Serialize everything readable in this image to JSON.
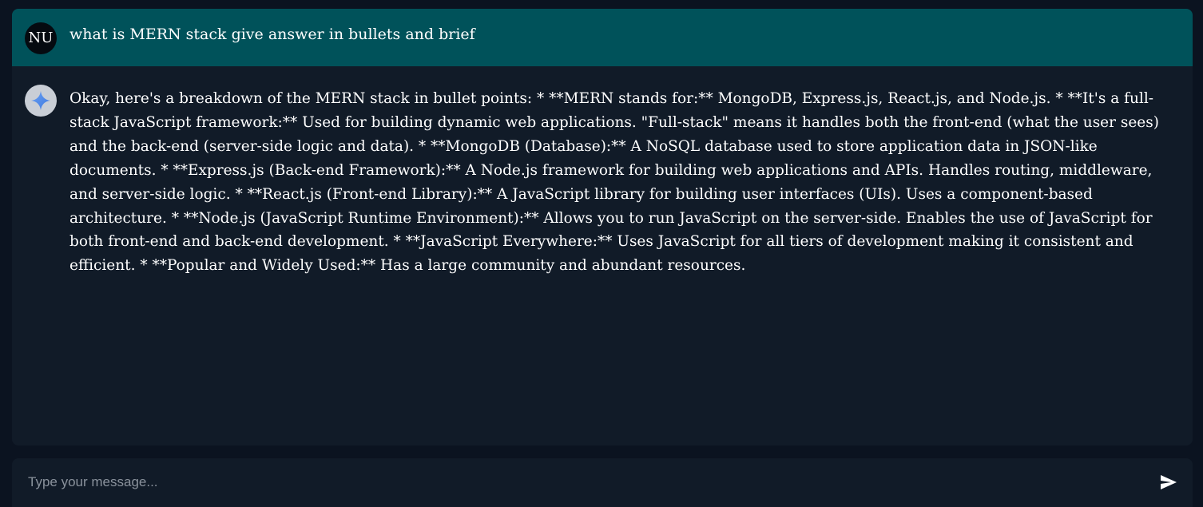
{
  "conversation": {
    "user_message": {
      "avatar_initials": "NU",
      "text": "what is MERN stack give answer in bullets and brief"
    },
    "bot_message": {
      "avatar_icon": "sparkle-icon",
      "text": "Okay, here's a breakdown of the MERN stack in bullet points: * **MERN stands for:** MongoDB, Express.js, React.js, and Node.js. * **It's a full-stack JavaScript framework:** Used for building dynamic web applications. \"Full-stack\" means it handles both the front-end (what the user sees) and the back-end (server-side logic and data). * **MongoDB (Database):** A NoSQL database used to store application data in JSON-like documents. * **Express.js (Back-end Framework):** A Node.js framework for building web applications and APIs. Handles routing, middleware, and server-side logic. * **React.js (Front-end Library):** A JavaScript library for building user interfaces (UIs). Uses a component-based architecture. * **Node.js (JavaScript Runtime Environment):** Allows you to run JavaScript on the server-side. Enables the use of JavaScript for both front-end and back-end development. * **JavaScript Everywhere:** Uses JavaScript for all tiers of development making it consistent and efficient. * **Popular and Widely Used:** Has a large community and abundant resources."
    }
  },
  "composer": {
    "placeholder": "Type your message...",
    "value": "",
    "send_icon": "send-icon"
  },
  "colors": {
    "background": "#0b1320",
    "panel": "#111b28",
    "user_bubble": "#00525a",
    "text": "#ffffff",
    "placeholder": "#8a929c"
  }
}
